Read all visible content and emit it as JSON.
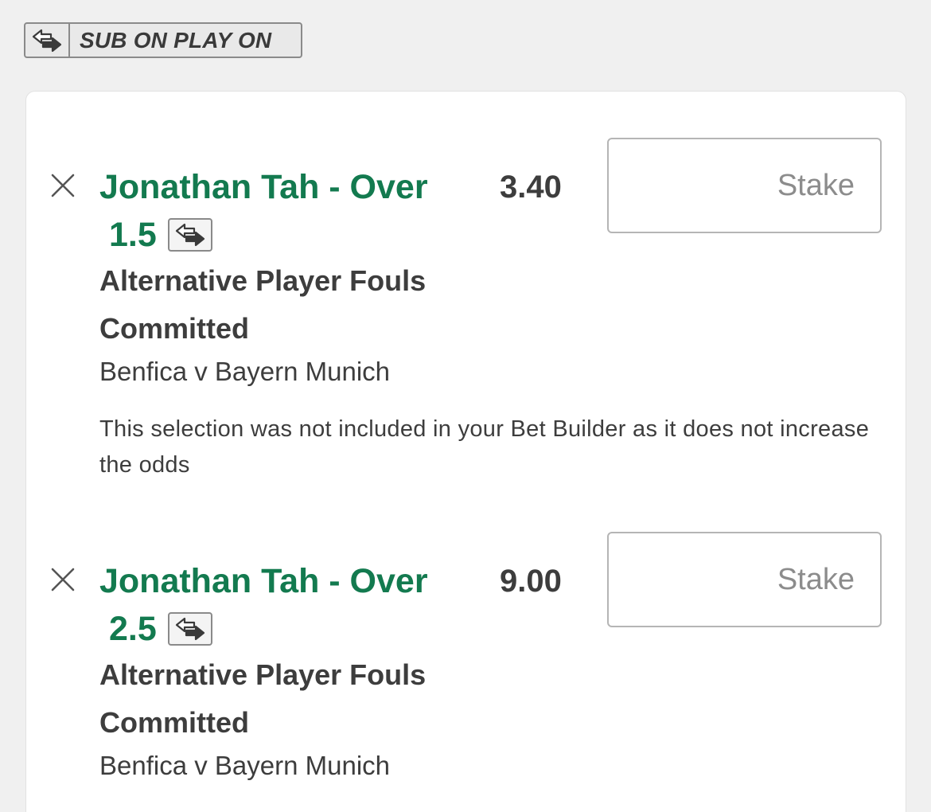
{
  "badge": {
    "label": "SUB ON PLAY ON",
    "icon": "sub-on-play-on-icon"
  },
  "selections": [
    {
      "name_line1": "Jonathan Tah - Over",
      "handicap": "1.5",
      "odds": "3.40",
      "stake_placeholder": "Stake",
      "stake_value": "",
      "market": "Alternative Player Fouls Committed",
      "event": "Benfica v Bayern Munich",
      "notice": "This selection was not included in your Bet Builder as it does not increase the odds"
    },
    {
      "name_line1": "Jonathan Tah - Over",
      "handicap": "2.5",
      "odds": "9.00",
      "stake_placeholder": "Stake",
      "stake_value": "",
      "market": "Alternative Player Fouls Committed",
      "event": "Benfica v Bayern Munich"
    }
  ],
  "colors": {
    "selection_name": "#137a4f",
    "text": "#3d3d3d",
    "background": "#f0f0f0",
    "card": "#ffffff"
  }
}
